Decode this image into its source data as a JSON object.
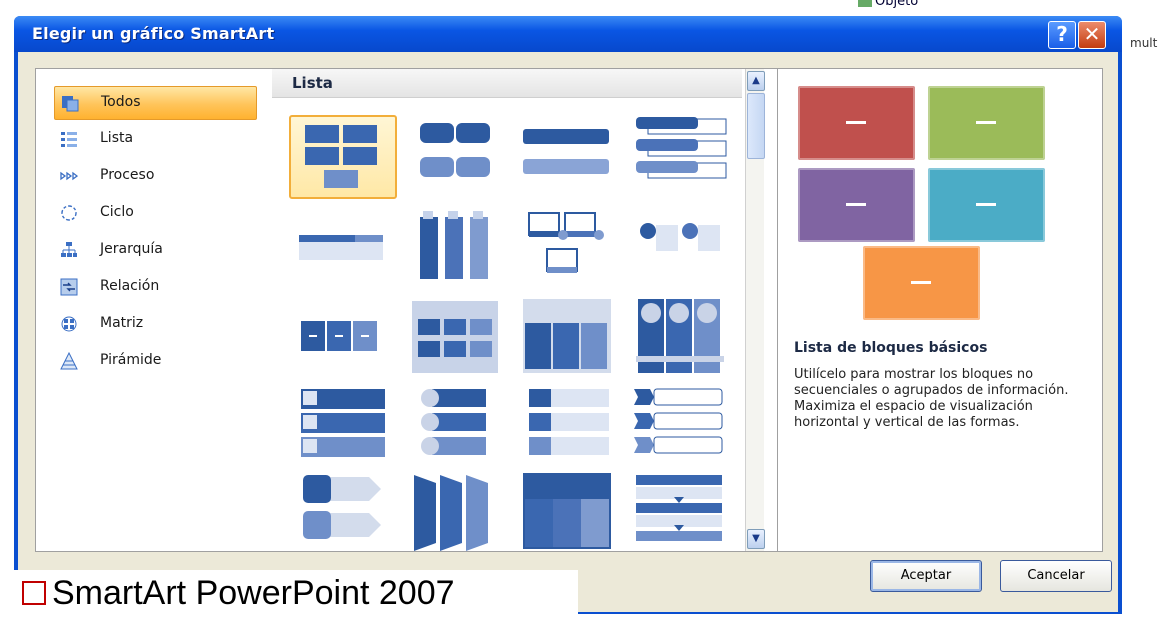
{
  "dialog": {
    "title": "Elegir un gráfico SmartArt",
    "help_label": "?",
    "close_label": "✕"
  },
  "categories": [
    {
      "label": "Todos",
      "icon": "all-icon",
      "selected": true
    },
    {
      "label": "Lista",
      "icon": "list-icon"
    },
    {
      "label": "Proceso",
      "icon": "process-icon"
    },
    {
      "label": "Ciclo",
      "icon": "cycle-icon"
    },
    {
      "label": "Jerarquía",
      "icon": "hierarchy-icon"
    },
    {
      "label": "Relación",
      "icon": "relationship-icon"
    },
    {
      "label": "Matriz",
      "icon": "matrix-icon"
    },
    {
      "label": "Pirámide",
      "icon": "pyramid-icon"
    }
  ],
  "gallery": {
    "header": "Lista",
    "scroll_up": "▲",
    "scroll_down": "▼"
  },
  "preview": {
    "title": "Lista de bloques básicos",
    "description": "Utilícelo para mostrar los bloques no secuenciales o agrupados de información. Maximiza el espacio de visualización horizontal y vertical de las formas.",
    "colors": [
      "#c0504d",
      "#9bbb59",
      "#8064a2",
      "#4bacc6",
      "#f79646"
    ]
  },
  "buttons": {
    "ok": "Aceptar",
    "cancel": "Cancelar"
  },
  "caption": {
    "text": "SmartArt PowerPoint 2007"
  },
  "background": {
    "right_text": "mult",
    "objeto_text": "Objeto"
  }
}
